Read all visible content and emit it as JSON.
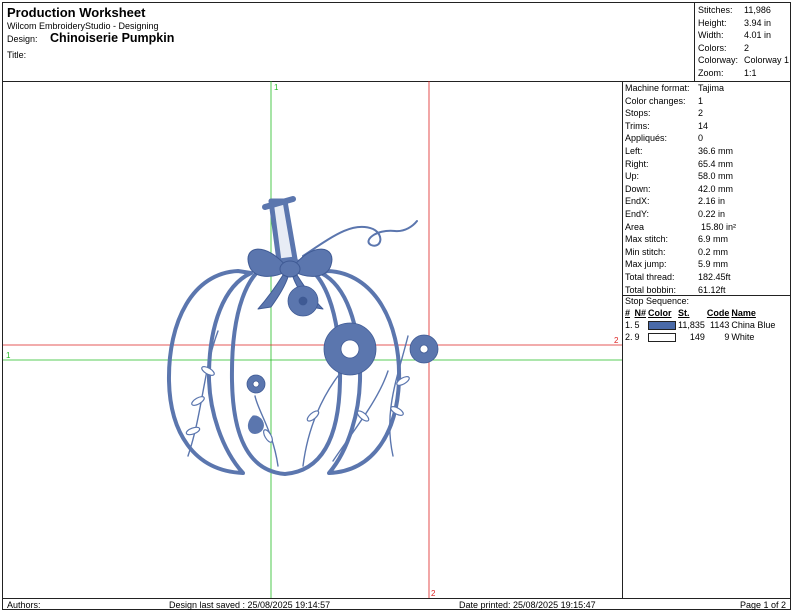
{
  "header": {
    "title": "Production Worksheet",
    "software": "Wilcom EmbroideryStudio - Designing",
    "design_label": "Design:",
    "design_name": "Chinoiserie Pumpkin",
    "title_label": "Title:",
    "title_value": ""
  },
  "stats": [
    {
      "label": "Stitches:",
      "value": "11,986"
    },
    {
      "label": "Height:",
      "value": "3.94 in"
    },
    {
      "label": "Width:",
      "value": "4.01 in"
    },
    {
      "label": "Colors:",
      "value": "2"
    },
    {
      "label": "Colorway:",
      "value": "Colorway 1"
    },
    {
      "label": "Zoom:",
      "value": "1:1"
    }
  ],
  "machine_info": [
    {
      "label": "Machine format:",
      "value": "Tajima"
    },
    {
      "label": "Color changes:",
      "value": "1"
    },
    {
      "label": "Stops:",
      "value": "2"
    },
    {
      "label": "Trims:",
      "value": "14"
    },
    {
      "label": "Appliqués:",
      "value": "0"
    },
    {
      "label": "Left:",
      "value": "36.6 mm"
    },
    {
      "label": "Right:",
      "value": "65.4 mm"
    },
    {
      "label": "Up:",
      "value": "58.0 mm"
    },
    {
      "label": "Down:",
      "value": "42.0 mm"
    },
    {
      "label": "EndX:",
      "value": "2.16 in"
    },
    {
      "label": "EndY:",
      "value": "0.22 in"
    },
    {
      "label": "Area",
      "value": "15.80 in²"
    },
    {
      "label": "Max stitch:",
      "value": "6.9 mm"
    },
    {
      "label": "Min stitch:",
      "value": "0.2 mm"
    },
    {
      "label": "Max jump:",
      "value": "5.9 mm"
    },
    {
      "label": "Total thread:",
      "value": "182.45ft"
    },
    {
      "label": "Total bobbin:",
      "value": "61.12ft"
    }
  ],
  "stop_sequence": {
    "title": "Stop Sequence:",
    "headers": [
      "#",
      "N#",
      "Color",
      "St.",
      "Code",
      "Name"
    ],
    "rows": [
      {
        "num": "1.",
        "n": "5",
        "color": "#4a6aa8",
        "st": "11,835",
        "code": "1143",
        "name": "China Blue"
      },
      {
        "num": "2.",
        "n": "9",
        "color": "#ffffff",
        "st": "149",
        "code": "9",
        "name": "White"
      }
    ]
  },
  "canvas": {
    "thread_color": "#5b76ae",
    "axis_green": "#22bb22",
    "axis_red": "#dd2222",
    "markers": {
      "top_green": "1",
      "left_green": "1",
      "right_red": "2",
      "bottom_red": "2"
    }
  },
  "footer": {
    "authors": "Authors:",
    "saved": "Design last saved : 25/08/2025 19:14:57",
    "printed": "Date printed: 25/08/2025 19:15:47",
    "page": "Page 1 of 2"
  }
}
